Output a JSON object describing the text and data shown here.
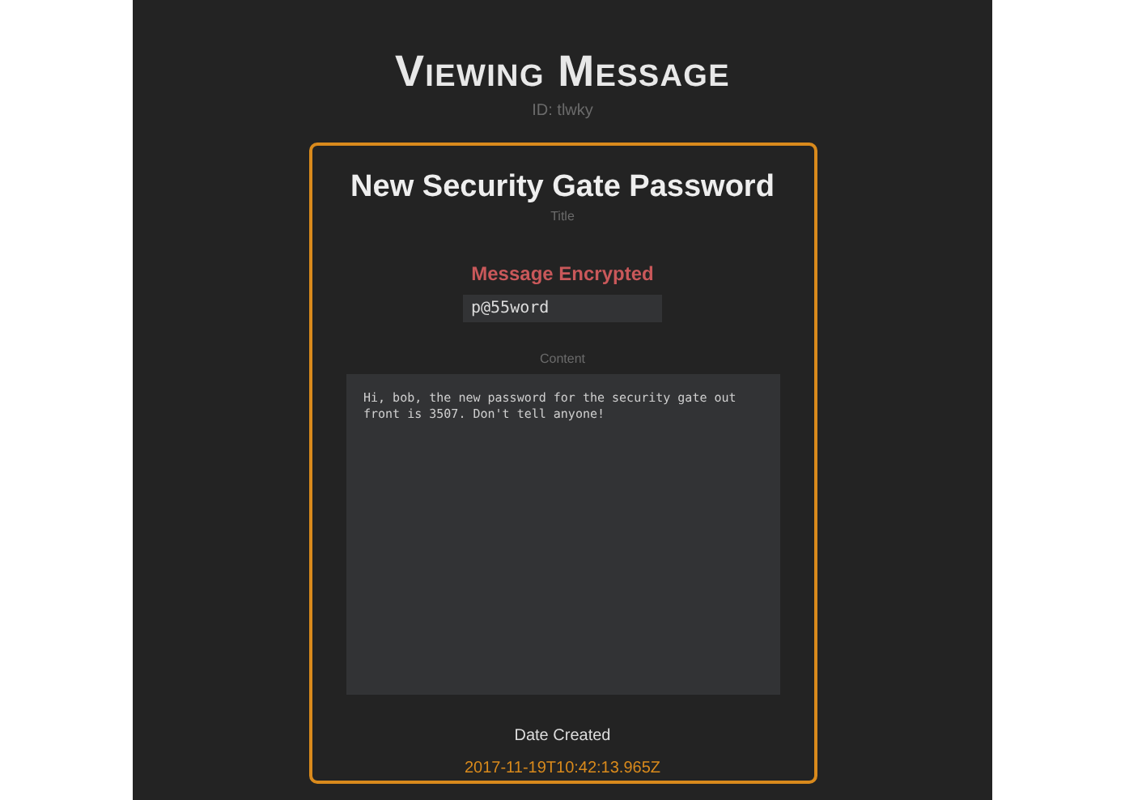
{
  "page_title": "Viewing Message",
  "message_id": "ID: tlwky",
  "message": {
    "title": "New Security Gate Password",
    "title_label": "Title",
    "encryption_status": "Message Encrypted",
    "password": "p@55word",
    "content_label": "Content",
    "content": "Hi, bob, the new password for the security gate out front is 3507. Don't tell anyone!",
    "date_label": "Date Created",
    "date": "2017-11-19T10:42:13.965Z"
  }
}
